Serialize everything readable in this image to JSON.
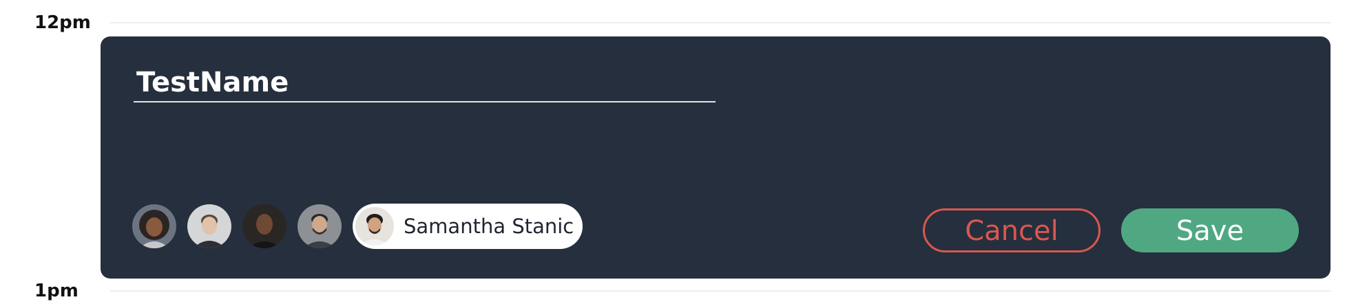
{
  "calendar": {
    "hours": [
      "12pm",
      "1pm"
    ]
  },
  "event_editor": {
    "title_value": "TestName",
    "attendees": [
      {
        "avatar": "avatar-woman-curly-hair"
      },
      {
        "avatar": "avatar-man-light-shirt"
      },
      {
        "avatar": "avatar-man-bald-dark"
      },
      {
        "avatar": "avatar-man-beard"
      }
    ],
    "selected_attendee": {
      "name": "Samantha Stanic",
      "avatar": "avatar-man-dark-hair"
    },
    "cancel_label": "Cancel",
    "save_label": "Save"
  },
  "colors": {
    "card_background": "#262f3d",
    "cancel": "#d9584f",
    "save": "#4fa882",
    "title_text": "#ffffff"
  }
}
